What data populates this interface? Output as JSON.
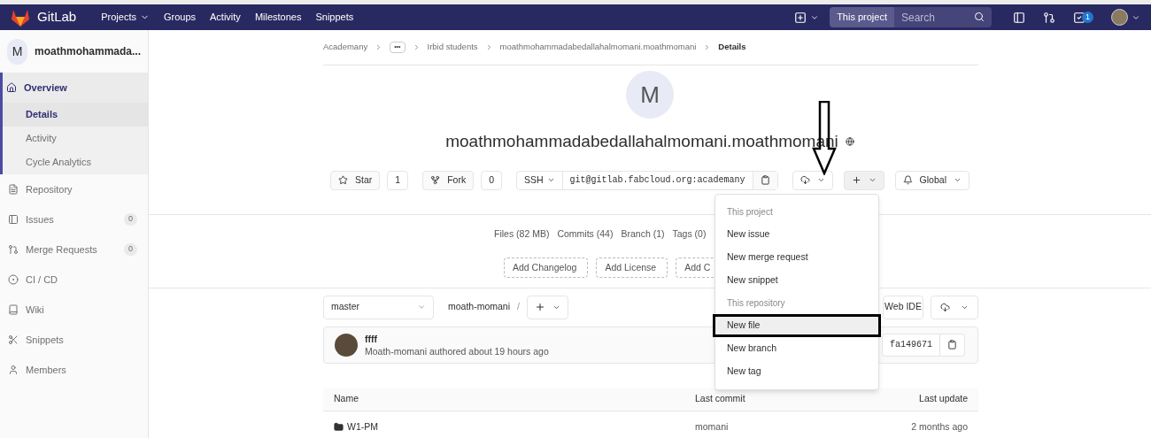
{
  "navbar": {
    "logo_text": "GitLab",
    "menu": [
      {
        "label": "Projects",
        "caret": true
      },
      {
        "label": "Groups",
        "caret": false
      },
      {
        "label": "Activity",
        "caret": false
      },
      {
        "label": "Milestones",
        "caret": false
      },
      {
        "label": "Snippets",
        "caret": false
      }
    ],
    "scope": "This project",
    "search": {
      "placeholder": "Search"
    },
    "todo_count": "1"
  },
  "sidebar": {
    "project": {
      "initial": "M",
      "name": "moathmohammada..."
    },
    "items": [
      {
        "label": "Overview",
        "selected": true,
        "children": [
          {
            "label": "Details",
            "selected": true
          },
          {
            "label": "Activity",
            "selected": false
          },
          {
            "label": "Cycle Analytics",
            "selected": false
          }
        ]
      },
      {
        "label": "Repository",
        "selected": false
      },
      {
        "label": "Issues",
        "selected": false,
        "count": "0"
      },
      {
        "label": "Merge Requests",
        "selected": false,
        "count": "0"
      },
      {
        "label": "CI / CD",
        "selected": false
      },
      {
        "label": "Wiki",
        "selected": false
      },
      {
        "label": "Snippets",
        "selected": false
      },
      {
        "label": "Members",
        "selected": false
      }
    ]
  },
  "breadcrumb": [
    "Academany",
    "•••",
    "Irbid students",
    "moathmohammadabedallahalmomani.moathmomani",
    "Details"
  ],
  "project": {
    "initial": "M",
    "title": "moathmohammadabedallahalmomani.moathmomani"
  },
  "actions": {
    "star": {
      "label": "Star",
      "count": "1"
    },
    "fork": {
      "label": "Fork",
      "count": "0"
    },
    "clone": {
      "protocol": "SSH",
      "url": "git@gitlab.fabcloud.org:academany"
    },
    "notification": {
      "label": "Global"
    }
  },
  "stats": [
    "Files (82 MB)",
    "Commits (44)",
    "Branch (1)",
    "Tags (0)"
  ],
  "add_buttons": [
    "Add Changelog",
    "Add License",
    "Add C"
  ],
  "tree": {
    "branch": "master",
    "path": "moath-momani",
    "separator": "/",
    "web_ide": "Web IDE"
  },
  "commit": {
    "message": "ffff",
    "author_line": "Moath-momani authored about 19 hours ago",
    "sha": "fa149671"
  },
  "table": {
    "columns": [
      "Name",
      "Last commit",
      "Last update"
    ],
    "rows": [
      {
        "name": "W1-PM",
        "last_commit": "momani",
        "last_update": "2 months ago"
      }
    ]
  },
  "dropdown": {
    "sections": [
      {
        "heading": "This project",
        "items": [
          {
            "label": "New issue",
            "selected": false
          },
          {
            "label": "New merge request",
            "selected": false
          },
          {
            "label": "New snippet",
            "selected": false
          }
        ]
      },
      {
        "heading": "This repository",
        "items": [
          {
            "label": "New file",
            "selected": true
          },
          {
            "label": "New branch",
            "selected": false
          },
          {
            "label": "New tag",
            "selected": false
          }
        ]
      }
    ]
  }
}
